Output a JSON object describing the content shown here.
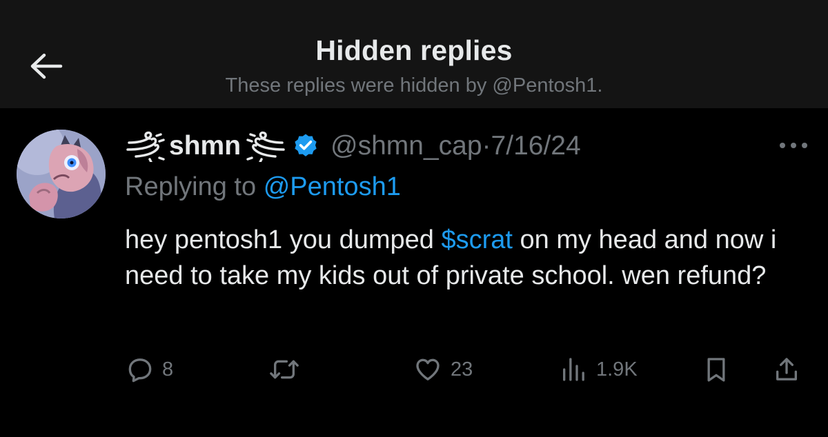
{
  "header": {
    "title": "Hidden replies",
    "subtitle": "These replies were hidden by @Pentosh1."
  },
  "tweet": {
    "display_name": "shmn",
    "handle": "@shmn_cap",
    "separator": "·",
    "date": "7/16/24",
    "replying_prefix": "Replying to",
    "replying_to": "@Pentosh1",
    "text_before": "hey pentosh1 you dumped",
    "cashtag": "$scrat",
    "text_after": "on my head and now i need to take my kids out of private school. wen refund?",
    "stats": {
      "replies": "8",
      "likes": "23",
      "views": "1.9K"
    }
  },
  "colors": {
    "background": "#000000",
    "header_background": "#141414",
    "text_primary": "#e7e9ea",
    "text_secondary": "#71767b",
    "accent": "#1d9bf0"
  },
  "icons": {
    "back": "arrow-left-icon",
    "verified": "verified-badge-icon",
    "more": "more-horizontal-icon",
    "reply": "reply-icon",
    "retweet": "retweet-icon",
    "like": "heart-icon",
    "views": "views-icon",
    "bookmark": "bookmark-icon",
    "share": "share-icon"
  }
}
